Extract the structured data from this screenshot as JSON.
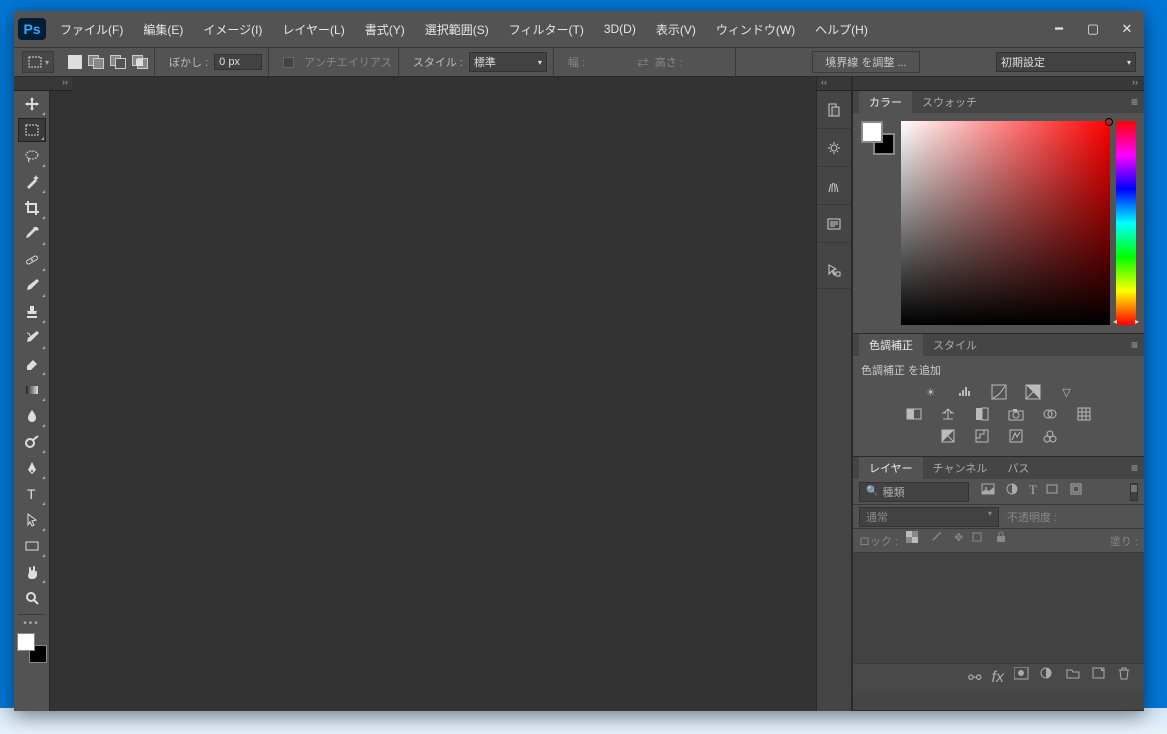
{
  "app": {
    "logo": "Ps"
  },
  "menus": [
    "ファイル(F)",
    "編集(E)",
    "イメージ(I)",
    "レイヤー(L)",
    "書式(Y)",
    "選択範囲(S)",
    "フィルター(T)",
    "3D(D)",
    "表示(V)",
    "ウィンドウ(W)",
    "ヘルプ(H)"
  ],
  "options": {
    "feather_label": "ぼかし :",
    "feather_value": "0 px",
    "antialias": "アンチエイリアス",
    "style_label": "スタイル :",
    "style_value": "標準",
    "width_label": "幅 :",
    "height_label": "高さ :",
    "refine": "境界線 を調整 ...",
    "workspace": "初期設定"
  },
  "panels": {
    "color": {
      "tab1": "カラー",
      "tab2": "スウォッチ"
    },
    "adjust": {
      "tab1": "色調補正",
      "tab2": "スタイル",
      "add_label": "色調補正 を追加"
    },
    "layers": {
      "tab1": "レイヤー",
      "tab2": "チャンネル",
      "tab3": "パス",
      "filter_kind": "種類",
      "blend_mode": "通常",
      "opacity_label": "不透明度 :",
      "lock_label": "ロック :",
      "fill_label": "塗り :"
    }
  }
}
